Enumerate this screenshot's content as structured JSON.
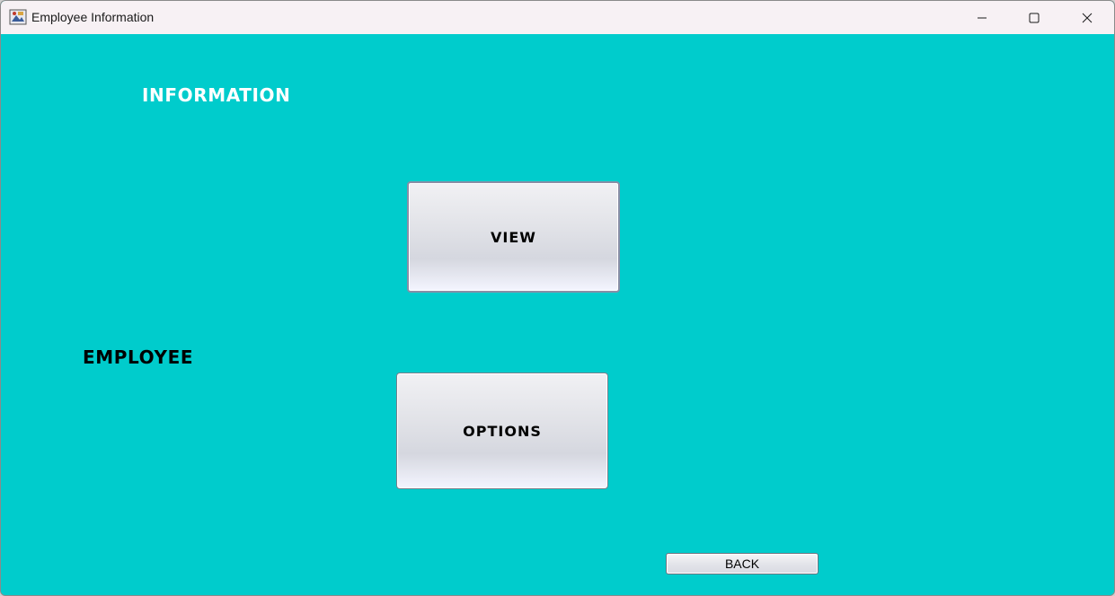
{
  "window": {
    "title": "Employee Information",
    "controls": {
      "minimize_icon": "minimize-icon",
      "maximize_icon": "maximize-icon",
      "close_icon": "close-icon"
    }
  },
  "content": {
    "heading_information": "INFORMATION",
    "heading_employee": "EMPLOYEE",
    "view_label": "VIEW",
    "options_label": "OPTIONS",
    "back_label": "BACK"
  },
  "colors": {
    "background": "#00cccc",
    "information_text": "#ffffff",
    "employee_text": "#000000"
  }
}
